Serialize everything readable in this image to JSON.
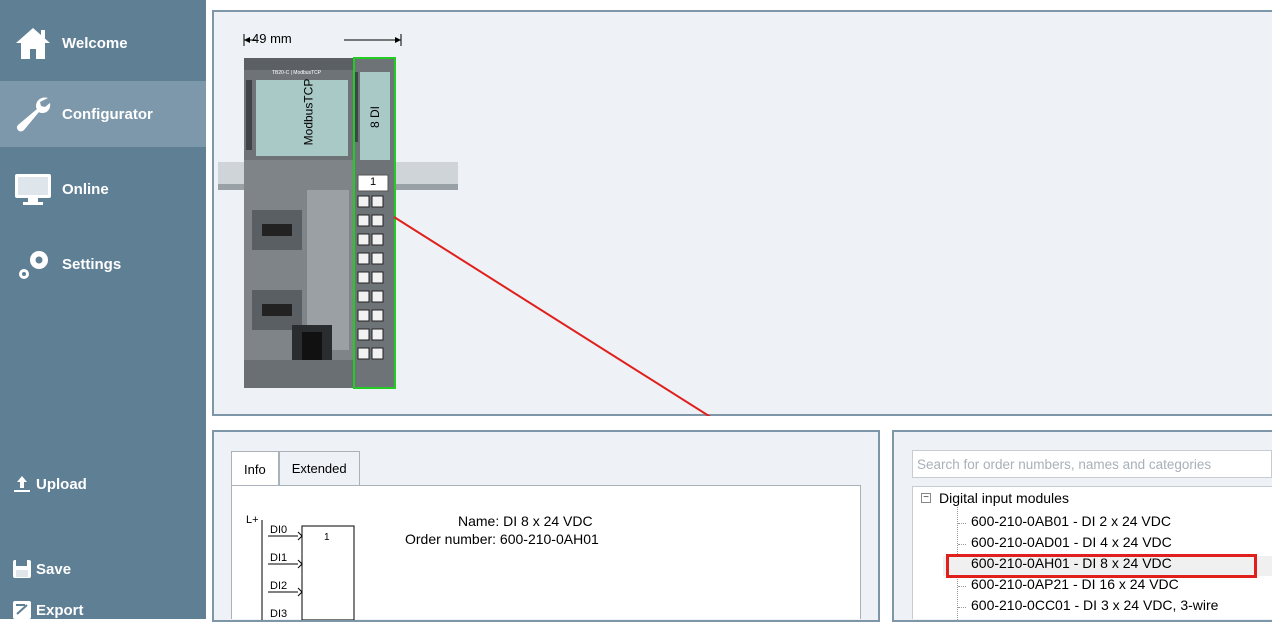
{
  "sidebar": {
    "nav": [
      {
        "label": "Welcome",
        "icon": "home-icon"
      },
      {
        "label": "Configurator",
        "icon": "wrench-icon",
        "active": true
      },
      {
        "label": "Online",
        "icon": "monitor-icon"
      },
      {
        "label": "Settings",
        "icon": "gears-icon"
      }
    ],
    "actions": [
      {
        "label": "Upload",
        "icon": "upload-icon"
      },
      {
        "label": "Save",
        "icon": "save-icon"
      },
      {
        "label": "Export",
        "icon": "export-icon"
      }
    ]
  },
  "canvas": {
    "dimension_label": "49 mm",
    "cpu_label": "ModbusTCP",
    "cpu_model": "TB20-C | ModbusTCP",
    "module_label": "8 DI",
    "slot_number": "1"
  },
  "details": {
    "tabs": [
      "Info",
      "Extended"
    ],
    "active_tab": "Info",
    "name_label": "Name: DI 8 x 24 VDC",
    "order_label": "Order number: 600-210-0AH01",
    "diagram": {
      "supply": "L+",
      "inputs": [
        "DI0",
        "DI1",
        "DI2",
        "DI3"
      ],
      "channel_number": "1"
    }
  },
  "catalog": {
    "search_placeholder": "Search for order numbers, names and categories",
    "category": "Digital input modules",
    "items": [
      "600-210-0AB01 - DI 2 x 24 VDC",
      "600-210-0AD01 - DI 4 x 24 VDC",
      "600-210-0AH01 - DI 8 x 24 VDC",
      "600-210-0AP21 - DI 16 x 24 VDC",
      "600-210-0CC01 - DI 3 x 24 VDC, 3-wire"
    ],
    "selected_index": 2,
    "highlight_color": "#e0201c"
  },
  "colors": {
    "sidebar": "#5f7f95",
    "sidebar_active": "#7d98ab",
    "panel_border": "#7d97a8",
    "module_outline": "#22cc22",
    "annotation": "#e0201c"
  }
}
